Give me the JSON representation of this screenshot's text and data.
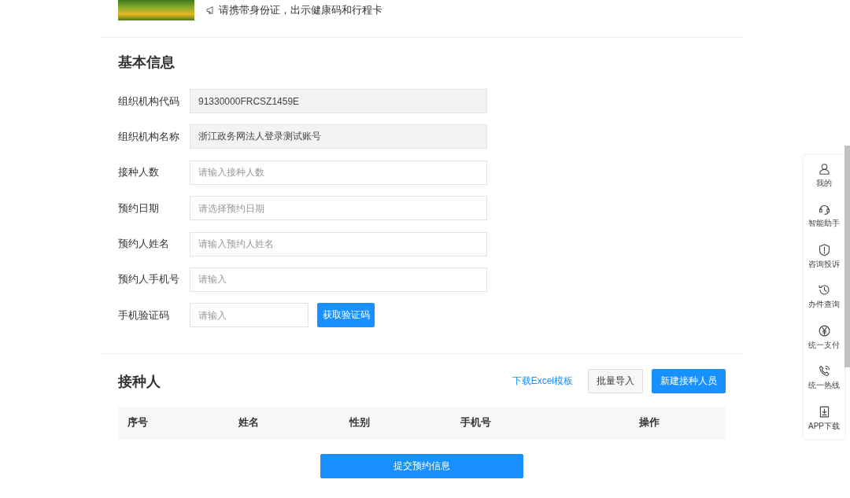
{
  "banner": {
    "notice": "请携带身份证，出示健康码和行程卡"
  },
  "basic_info": {
    "title": "基本信息",
    "fields": [
      {
        "label": "组织机构代码",
        "value": "91330000FRCSZ1459E",
        "disabled": true,
        "kind": "text"
      },
      {
        "label": "组织机构名称",
        "value": "浙江政务网法人登录测试账号",
        "disabled": true,
        "kind": "text"
      },
      {
        "label": "接种人数",
        "placeholder": "请输入接种人数",
        "disabled": false,
        "kind": "text"
      },
      {
        "label": "预约日期",
        "placeholder": "请选择预约日期",
        "disabled": false,
        "kind": "text"
      },
      {
        "label": "预约人姓名",
        "placeholder": "请输入预约人姓名",
        "disabled": false,
        "kind": "text"
      },
      {
        "label": "预约人手机号",
        "placeholder": "请输入",
        "disabled": false,
        "kind": "text"
      },
      {
        "label": "手机验证码",
        "placeholder": "请输入",
        "disabled": false,
        "kind": "code",
        "button": "获取验证码"
      }
    ]
  },
  "recipients": {
    "title": "接种人",
    "link": "下载Excel模板",
    "buttons": [
      {
        "label": "批量导入",
        "kind": "default"
      },
      {
        "label": "新建接种人员",
        "kind": "primary"
      }
    ],
    "table": {
      "columns": [
        "序号",
        "姓名",
        "性别",
        "手机号",
        "操作"
      ]
    }
  },
  "submit": "提交预约信息",
  "side_menu": [
    {
      "label": "我的",
      "kind": "user"
    },
    {
      "label": "智能助手",
      "kind": "headset"
    },
    {
      "label": "咨询投诉",
      "kind": "shield"
    },
    {
      "label": "办件查询",
      "kind": "history"
    },
    {
      "label": "统一支付",
      "kind": "yen"
    },
    {
      "label": "统一热线",
      "kind": "phone"
    },
    {
      "label": "APP下载",
      "kind": "download"
    }
  ]
}
